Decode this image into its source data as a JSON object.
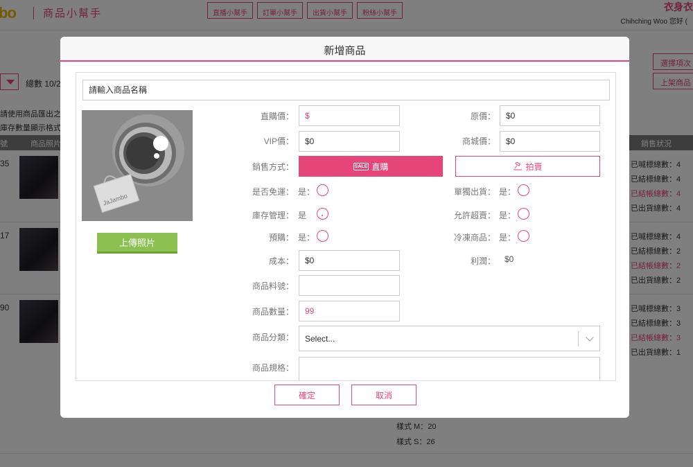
{
  "app": {
    "logo": "bo",
    "title": "商品小幫手",
    "nav": [
      "直播小幫手",
      "訂單小幫手",
      "出貨小幫手",
      "粉絲小幫手"
    ],
    "brand": "衣身衣",
    "greeting": "Chihching Woo 您好 ("
  },
  "list": {
    "total": "總數 10/2",
    "right_buttons": [
      "選擇項次",
      "上架商品"
    ],
    "notes": [
      "請使用商品匯出之",
      "庫存數量顯示格式"
    ],
    "headers": [
      "號",
      "商品照片",
      "銷售狀況"
    ],
    "rows": [
      {
        "num": "35",
        "stats": [
          "已喊標總數：4",
          "已結標總數：4",
          "已結帳總數：4",
          "已出貨總數：4"
        ]
      },
      {
        "num": "17",
        "stats": [
          "已喊標總數：4",
          "已結標總數：2",
          "已結帳總數：2",
          "已出貨總數：2"
        ]
      },
      {
        "num": "90",
        "stats": [
          "已喊標總數：3",
          "已結標總數：3",
          "已結帳總數：3",
          "已出貨總數：1"
        ]
      }
    ],
    "variants": [
      "樣式 M：20",
      "樣式 S：26"
    ]
  },
  "modal": {
    "title": "新增商品",
    "name_placeholder": "請輸入商品名稱",
    "upload_label": "上傳照片",
    "logo_text": "JaJambo",
    "labels": {
      "direct_price": "直購價：",
      "vip_price": "VIP價：",
      "sale_method": "銷售方式：",
      "free_shipping": "是否免運：",
      "inventory": "庫存管理：",
      "preorder": "預購：",
      "cost": "成本：",
      "sku": "商品料號：",
      "quantity": "商品數量：",
      "category": "商品分類：",
      "spec": "商品規格：",
      "original_price": "原價：",
      "mall_price": "商城價：",
      "single_ship": "單獨出貨：",
      "oversell": "允許超賣：",
      "frozen": "冷凍商品：",
      "profit": "利潤："
    },
    "yes_colon": "是：",
    "yes_plain": "是",
    "values": {
      "direct_price": "$",
      "vip_price": "$0",
      "original_price": "$0",
      "mall_price": "$0",
      "cost": "$0",
      "sku": "",
      "quantity": "99",
      "profit": "$0"
    },
    "sale_buttons": {
      "direct": "直購",
      "auction": "拍賣",
      "sale_badge": "SALE"
    },
    "category_placeholder": "Select...",
    "confirm": "確定",
    "cancel": "取消"
  },
  "colors": {
    "accent": "#e6457a",
    "upload_green": "#8cc152"
  }
}
